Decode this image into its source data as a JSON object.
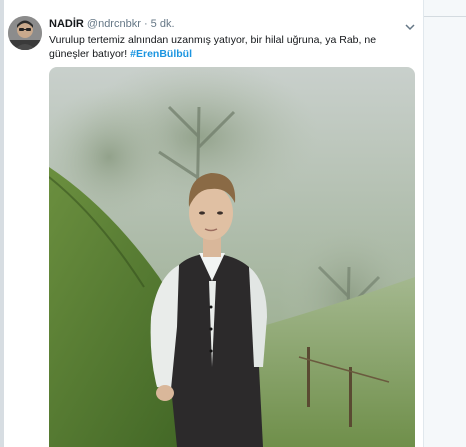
{
  "tweet": {
    "display_name": "NADİR",
    "handle": "@ndrcnbkr",
    "separator": "·",
    "timestamp": "5 dk.",
    "text_main": "Vurulup tertemiz alnından uzanmış yatıyor, bir hilal uğruna, ya Rab, ne güneşler batıyor! ",
    "hashtag": "#ErenBülbül"
  },
  "icons": {
    "avatar": "profile-avatar",
    "menu": "chevron-down-icon"
  },
  "colors": {
    "link": "#1b95e0",
    "background": "#e6ecf0",
    "text": "#14171a",
    "secondary": "#657786"
  }
}
